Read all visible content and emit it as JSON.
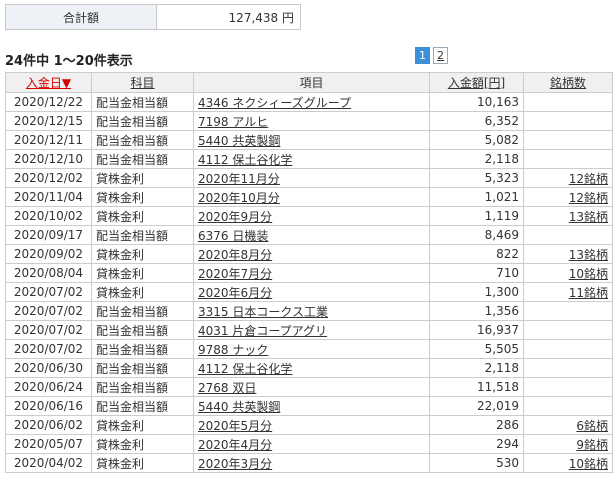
{
  "summary": {
    "label": "合計額",
    "value": "127,438 円"
  },
  "count_text": "24件中 1～20件表示",
  "pager": {
    "pages": [
      "1",
      "2"
    ],
    "current": "1"
  },
  "table": {
    "headers": {
      "date": "入金日▼",
      "category": "科目",
      "item": "項目",
      "amount": "入金額[円]",
      "brands": "銘柄数"
    },
    "rows": [
      {
        "date": "2020/12/22",
        "category": "配当金相当額",
        "item": "4346 ネクシィーズグループ",
        "amount": "10,163",
        "brands": ""
      },
      {
        "date": "2020/12/15",
        "category": "配当金相当額",
        "item": "7198 アルヒ",
        "amount": "6,352",
        "brands": ""
      },
      {
        "date": "2020/12/11",
        "category": "配当金相当額",
        "item": "5440 共英製鋼",
        "amount": "5,082",
        "brands": ""
      },
      {
        "date": "2020/12/10",
        "category": "配当金相当額",
        "item": "4112 保土谷化学",
        "amount": "2,118",
        "brands": ""
      },
      {
        "date": "2020/12/02",
        "category": "貸株金利",
        "item": "2020年11月分",
        "amount": "5,323",
        "brands": "12銘柄"
      },
      {
        "date": "2020/11/04",
        "category": "貸株金利",
        "item": "2020年10月分",
        "amount": "1,021",
        "brands": "12銘柄"
      },
      {
        "date": "2020/10/02",
        "category": "貸株金利",
        "item": "2020年9月分",
        "amount": "1,119",
        "brands": "13銘柄"
      },
      {
        "date": "2020/09/17",
        "category": "配当金相当額",
        "item": "6376 日機装",
        "amount": "8,469",
        "brands": ""
      },
      {
        "date": "2020/09/02",
        "category": "貸株金利",
        "item": "2020年8月分",
        "amount": "822",
        "brands": "13銘柄"
      },
      {
        "date": "2020/08/04",
        "category": "貸株金利",
        "item": "2020年7月分",
        "amount": "710",
        "brands": "10銘柄"
      },
      {
        "date": "2020/07/02",
        "category": "貸株金利",
        "item": "2020年6月分",
        "amount": "1,300",
        "brands": "11銘柄"
      },
      {
        "date": "2020/07/02",
        "category": "配当金相当額",
        "item": "3315 日本コークス工業",
        "amount": "1,356",
        "brands": ""
      },
      {
        "date": "2020/07/02",
        "category": "配当金相当額",
        "item": "4031 片倉コープアグリ",
        "amount": "16,937",
        "brands": ""
      },
      {
        "date": "2020/07/02",
        "category": "配当金相当額",
        "item": "9788 ナック",
        "amount": "5,505",
        "brands": ""
      },
      {
        "date": "2020/06/30",
        "category": "配当金相当額",
        "item": "4112 保土谷化学",
        "amount": "2,118",
        "brands": ""
      },
      {
        "date": "2020/06/24",
        "category": "配当金相当額",
        "item": "2768 双日",
        "amount": "11,518",
        "brands": ""
      },
      {
        "date": "2020/06/16",
        "category": "配当金相当額",
        "item": "5440 共英製鋼",
        "amount": "22,019",
        "brands": ""
      },
      {
        "date": "2020/06/02",
        "category": "貸株金利",
        "item": "2020年5月分",
        "amount": "286",
        "brands": "6銘柄"
      },
      {
        "date": "2020/05/07",
        "category": "貸株金利",
        "item": "2020年4月分",
        "amount": "294",
        "brands": "9銘柄"
      },
      {
        "date": "2020/04/02",
        "category": "貸株金利",
        "item": "2020年3月分",
        "amount": "530",
        "brands": "10銘柄"
      }
    ]
  }
}
